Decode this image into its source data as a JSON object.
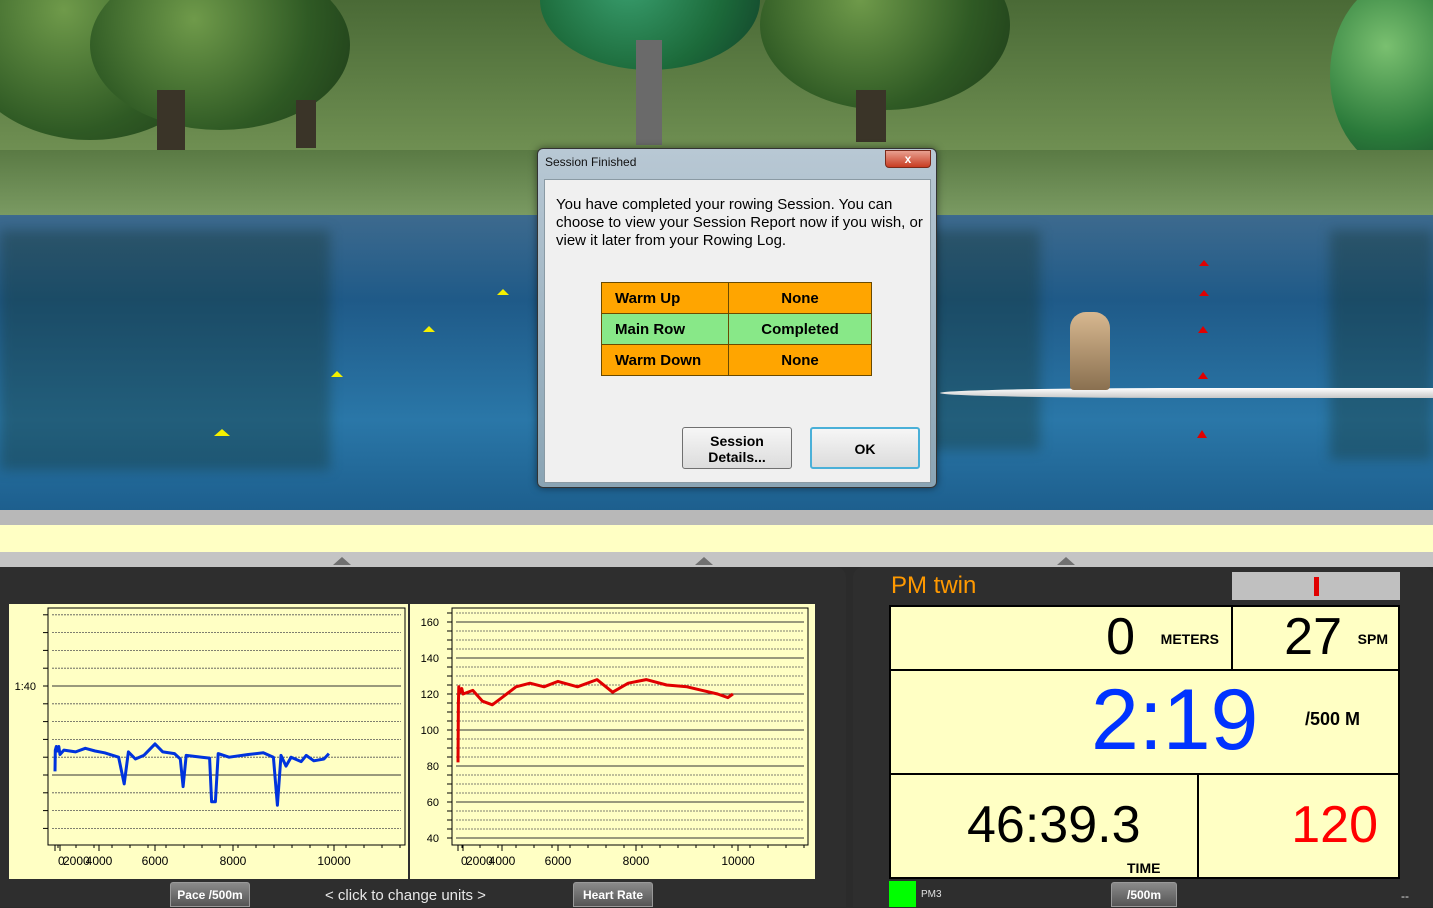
{
  "dialog": {
    "title": "Session Finished",
    "close_label": "x",
    "message": "You have completed your rowing Session.  You can choose to view your Session Report now if you wish, or view it later from your Rowing Log.",
    "segments": [
      {
        "name": "Warm Up",
        "status": "None",
        "color": "#ffa500"
      },
      {
        "name": "Main Row",
        "status": "Completed",
        "color": "#88e888"
      },
      {
        "name": "Warm Down",
        "status": "None",
        "color": "#ffa500"
      }
    ],
    "details_button": "Session Details...",
    "ok_button": "OK"
  },
  "charts": {
    "pace_tab": "Pace /500m",
    "units_hint": "<  click to change units  >",
    "hr_tab": "Heart Rate"
  },
  "chart_data": [
    {
      "type": "line",
      "title": "",
      "xlabel": "",
      "ylabel": "",
      "x_ticks": [
        "0",
        "2000",
        "4000",
        "6000",
        "8000",
        "10000"
      ],
      "y_tick_labels": [
        "1:40"
      ],
      "y_unit": "seconds per 500m (inverted, slower downward)",
      "ylim": [
        96,
        113
      ],
      "grid": true,
      "series": [
        {
          "color": "#0033dd",
          "points": [
            [
              0,
              109.6
            ],
            [
              100,
              107.2
            ],
            [
              500,
              106.8
            ],
            [
              1000,
              107.3
            ],
            [
              1500,
              106.8
            ],
            [
              2000,
              107.7
            ],
            [
              2200,
              107.2
            ],
            [
              2800,
              107.4
            ],
            [
              3300,
              107
            ],
            [
              3800,
              107.3
            ],
            [
              4200,
              107.5
            ],
            [
              4700,
              108
            ],
            [
              4900,
              111
            ],
            [
              5050,
              107.4
            ],
            [
              5300,
              108.2
            ],
            [
              5600,
              107.8
            ],
            [
              6000,
              106.5
            ],
            [
              6200,
              107.4
            ],
            [
              6500,
              107.6
            ],
            [
              6650,
              108.2
            ],
            [
              6720,
              111.3
            ],
            [
              6800,
              107.8
            ],
            [
              7200,
              108
            ],
            [
              7400,
              108.1
            ],
            [
              7450,
              113
            ],
            [
              7550,
              113
            ],
            [
              7620,
              107.6
            ],
            [
              7900,
              108
            ],
            [
              8300,
              107.7
            ],
            [
              8600,
              107.5
            ],
            [
              8800,
              108
            ],
            [
              8880,
              113.4
            ],
            [
              8950,
              107.8
            ],
            [
              9050,
              109
            ],
            [
              9150,
              108
            ],
            [
              9350,
              108.5
            ],
            [
              9450,
              107.8
            ],
            [
              9600,
              108.4
            ],
            [
              9800,
              108.2
            ],
            [
              9900,
              107.6
            ]
          ]
        }
      ]
    },
    {
      "type": "line",
      "title": "",
      "xlabel": "",
      "ylabel": "",
      "x_ticks": [
        "0",
        "2000",
        "4000",
        "6000",
        "8000",
        "10000"
      ],
      "y_ticks": [
        40,
        60,
        80,
        100,
        120,
        140,
        160
      ],
      "ylim": [
        40,
        160
      ],
      "grid": true,
      "series": [
        {
          "color": "#e00000",
          "points": [
            [
              0,
              82
            ],
            [
              150,
              115
            ],
            [
              300,
              124
            ],
            [
              800,
              121
            ],
            [
              1500,
              123
            ],
            [
              2000,
              120
            ],
            [
              2500,
              122
            ],
            [
              3000,
              116
            ],
            [
              3500,
              114
            ],
            [
              4000,
              118
            ],
            [
              4500,
              124
            ],
            [
              5000,
              126
            ],
            [
              5500,
              124
            ],
            [
              6000,
              127
            ],
            [
              6500,
              124
            ],
            [
              7000,
              128
            ],
            [
              7400,
              121
            ],
            [
              7800,
              126
            ],
            [
              8200,
              128
            ],
            [
              8600,
              125
            ],
            [
              9000,
              124
            ],
            [
              9300,
              122
            ],
            [
              9600,
              120
            ],
            [
              9800,
              118
            ],
            [
              9900,
              120
            ]
          ]
        }
      ]
    }
  ],
  "monitor": {
    "title": "PM twin",
    "meters": "0",
    "meters_label": "METERS",
    "spm": "27",
    "spm_label": "SPM",
    "pace": "2:19",
    "pace_label": "/500 M",
    "time": "46:39.3",
    "time_label": "TIME",
    "heart_rate": "120",
    "pm_label": "PM3",
    "units_tab": "/500m",
    "corner": "--",
    "status_color": "#00ff00",
    "pace_color": "#0033ff",
    "hr_color": "#ff0000",
    "title_color": "#ff9900"
  }
}
